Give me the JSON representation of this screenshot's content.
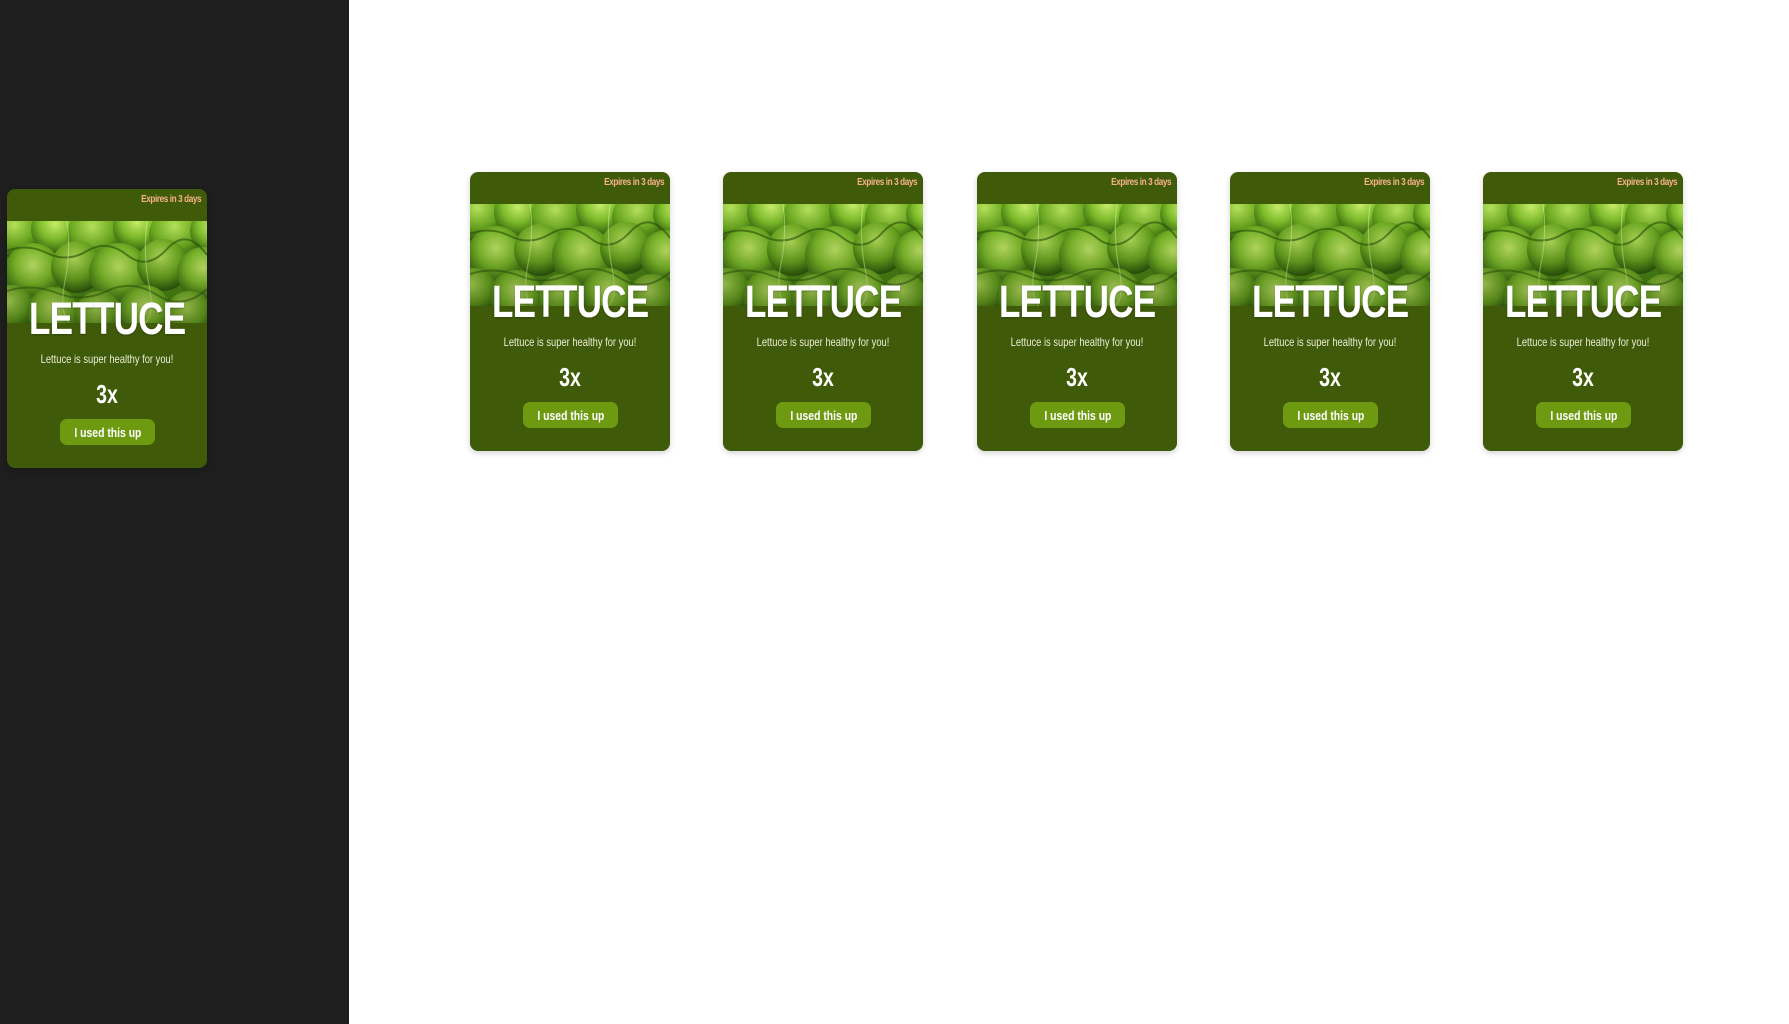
{
  "colors": {
    "sidebar_bg": "#1e1e1e",
    "main_bg": "#ffffff",
    "card_bg": "#3f5a08",
    "button_bg": "#6e9a12",
    "expires_text": "#f4b28a"
  },
  "sidebar": {
    "card": {
      "expires": "Expires in 3 days",
      "image": "lettuce-photo",
      "name": "LETTUCE",
      "description": "Lettuce is super healthy for you!",
      "quantity": "3x",
      "button_label": "I used this up"
    }
  },
  "main": {
    "cards": [
      {
        "expires": "Expires in 3 days",
        "image": "lettuce-photo",
        "name": "LETTUCE",
        "description": "Lettuce is super healthy for you!",
        "quantity": "3x",
        "button_label": "I used this up"
      },
      {
        "expires": "Expires in 3 days",
        "image": "lettuce-photo",
        "name": "LETTUCE",
        "description": "Lettuce is super healthy for you!",
        "quantity": "3x",
        "button_label": "I used this up"
      },
      {
        "expires": "Expires in 3 days",
        "image": "lettuce-photo",
        "name": "LETTUCE",
        "description": "Lettuce is super healthy for you!",
        "quantity": "3x",
        "button_label": "I used this up"
      },
      {
        "expires": "Expires in 3 days",
        "image": "lettuce-photo",
        "name": "LETTUCE",
        "description": "Lettuce is super healthy for you!",
        "quantity": "3x",
        "button_label": "I used this up"
      },
      {
        "expires": "Expires in 3 days",
        "image": "lettuce-photo",
        "name": "LETTUCE",
        "description": "Lettuce is super healthy for you!",
        "quantity": "3x",
        "button_label": "I used this up"
      }
    ]
  }
}
